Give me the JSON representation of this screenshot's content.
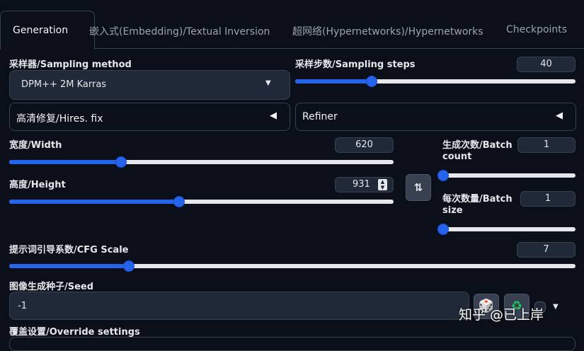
{
  "tabs": [
    {
      "label": "Generation",
      "active": true
    },
    {
      "label": "嵌入式(Embedding)/Textual Inversion"
    },
    {
      "label": "超网络(Hypernetworks)/Hypernetworks"
    },
    {
      "label": "Checkpoints"
    }
  ],
  "sampler": {
    "label": "采样器/Sampling method",
    "value": "DPM++ 2M Karras"
  },
  "steps": {
    "label": "采样步数/Sampling steps",
    "value": "40",
    "fraction": 0.27
  },
  "hires": {
    "label": "高清修复/Hires. fix"
  },
  "refiner": {
    "label": "Refiner"
  },
  "width": {
    "label": "宽度/Width",
    "value": "620",
    "fraction": 0.29
  },
  "height": {
    "label": "高度/Height",
    "value": "931",
    "fraction": 0.44
  },
  "batch_count": {
    "label_1": "生成次数/Batch",
    "label_2": "count",
    "value": "1",
    "fraction": 0.0
  },
  "batch_size": {
    "label_1": "每次数量/Batch",
    "label_2": "size",
    "value": "1",
    "fraction": 0.0
  },
  "cfg": {
    "label": "提示词引导系数/CFG Scale",
    "value": "7",
    "fraction": 0.21
  },
  "seed": {
    "label": "图像生成种子/Seed",
    "value": "-1"
  },
  "override": {
    "label": "覆盖设置/Override settings"
  },
  "watermark": {
    "text": "知乎 @已上岸"
  },
  "colors": {
    "accent": "#2563eb",
    "background": "#0b0f19",
    "panel": "#1f2937",
    "border": "#374151"
  }
}
